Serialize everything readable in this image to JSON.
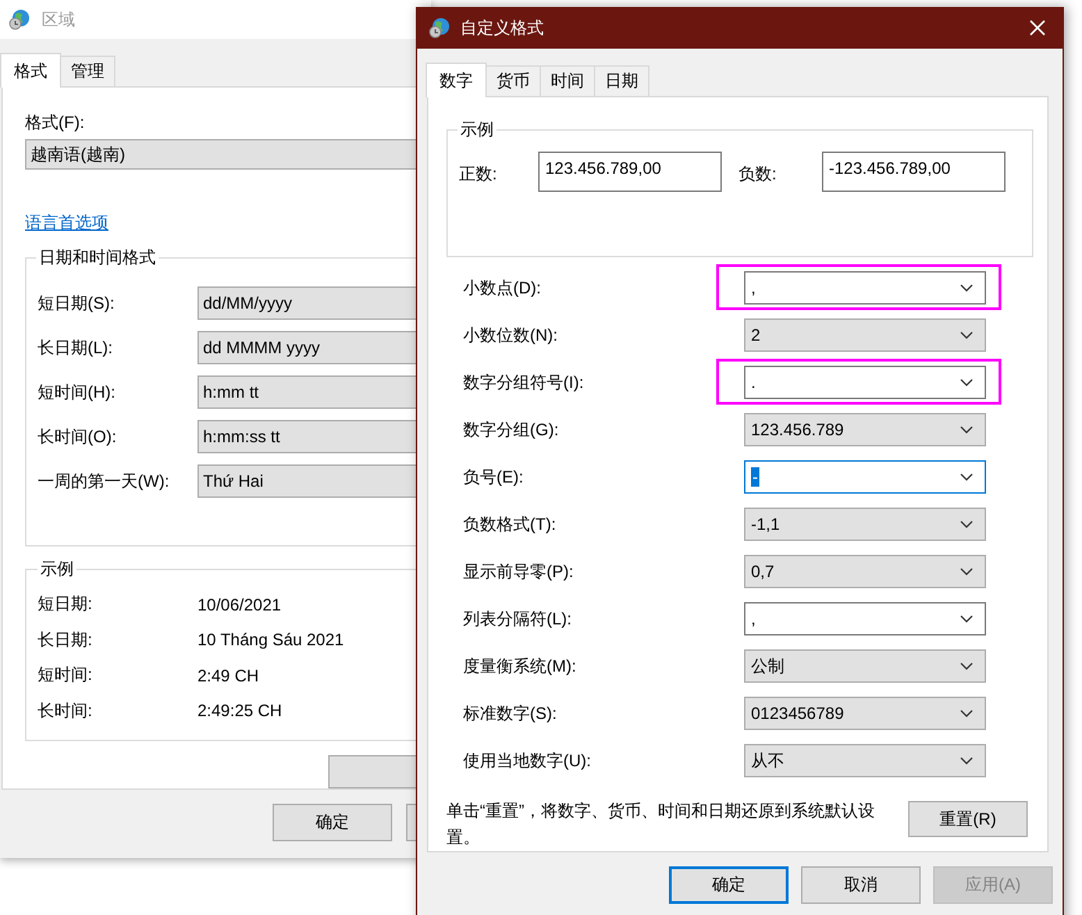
{
  "background_window": {
    "title": "区域",
    "tabs": [
      {
        "label": "格式",
        "selected": true
      },
      {
        "label": "管理",
        "selected": false
      }
    ],
    "format_label": "格式(F):",
    "format_value": "越南语(越南)",
    "language_link": "语言首选项",
    "datetime_group": {
      "title": "日期和时间格式",
      "rows": [
        {
          "label": "短日期(S):",
          "value": "dd/MM/yyyy"
        },
        {
          "label": "长日期(L):",
          "value": "dd MMMM yyyy"
        },
        {
          "label": "短时间(H):",
          "value": "h:mm tt"
        },
        {
          "label": "长时间(O):",
          "value": "h:mm:ss tt"
        },
        {
          "label": "一周的第一天(W):",
          "value": "Thứ Hai"
        }
      ]
    },
    "example_group": {
      "title": "示例",
      "rows": [
        {
          "label": "短日期:",
          "value": "10/06/2021"
        },
        {
          "label": "长日期:",
          "value": "10 Tháng Sáu 2021"
        },
        {
          "label": "短时间:",
          "value": "2:49 CH"
        },
        {
          "label": "长时间:",
          "value": "2:49:25 CH"
        }
      ]
    },
    "buttons": [
      {
        "label": "确定"
      }
    ]
  },
  "dialog": {
    "title": "自定义格式",
    "tabs": [
      {
        "label": "数字",
        "selected": true
      },
      {
        "label": "货币",
        "selected": false
      },
      {
        "label": "时间",
        "selected": false
      },
      {
        "label": "日期",
        "selected": false
      }
    ],
    "example": {
      "title": "示例",
      "positive_label": "正数:",
      "positive_value": "123.456.789,00",
      "negative_label": "负数:",
      "negative_value": "-123.456.789,00"
    },
    "settings": [
      {
        "label": "小数点(D):",
        "value": ",",
        "editable": true,
        "focused": false,
        "highlighted": true
      },
      {
        "label": "小数位数(N):",
        "value": "2",
        "editable": false,
        "focused": false,
        "highlighted": false
      },
      {
        "label": "数字分组符号(I):",
        "value": ".",
        "editable": true,
        "focused": false,
        "highlighted": true
      },
      {
        "label": "数字分组(G):",
        "value": "123.456.789",
        "editable": false,
        "focused": false,
        "highlighted": false
      },
      {
        "label": "负号(E):",
        "value": "-",
        "editable": true,
        "focused": true,
        "highlighted": false
      },
      {
        "label": "负数格式(T):",
        "value": "-1,1",
        "editable": false,
        "focused": false,
        "highlighted": false
      },
      {
        "label": "显示前导零(P):",
        "value": "0,7",
        "editable": false,
        "focused": false,
        "highlighted": false
      },
      {
        "label": "列表分隔符(L):",
        "value": ",",
        "editable": true,
        "focused": false,
        "highlighted": false
      },
      {
        "label": "度量衡系统(M):",
        "value": "公制",
        "editable": false,
        "focused": false,
        "highlighted": false
      },
      {
        "label": "标准数字(S):",
        "value": "0123456789",
        "editable": false,
        "focused": false,
        "highlighted": false
      },
      {
        "label": "使用当地数字(U):",
        "value": "从不",
        "editable": false,
        "focused": false,
        "highlighted": false
      }
    ],
    "note": "单击“重置”，将数字、货币、时间和日期还原到系统默认设置。",
    "reset_button": "重置(R)",
    "buttons": [
      {
        "label": "确定",
        "default": true,
        "disabled": false
      },
      {
        "label": "取消",
        "default": false,
        "disabled": false
      },
      {
        "label": "应用(A)",
        "default": false,
        "disabled": true
      }
    ]
  }
}
